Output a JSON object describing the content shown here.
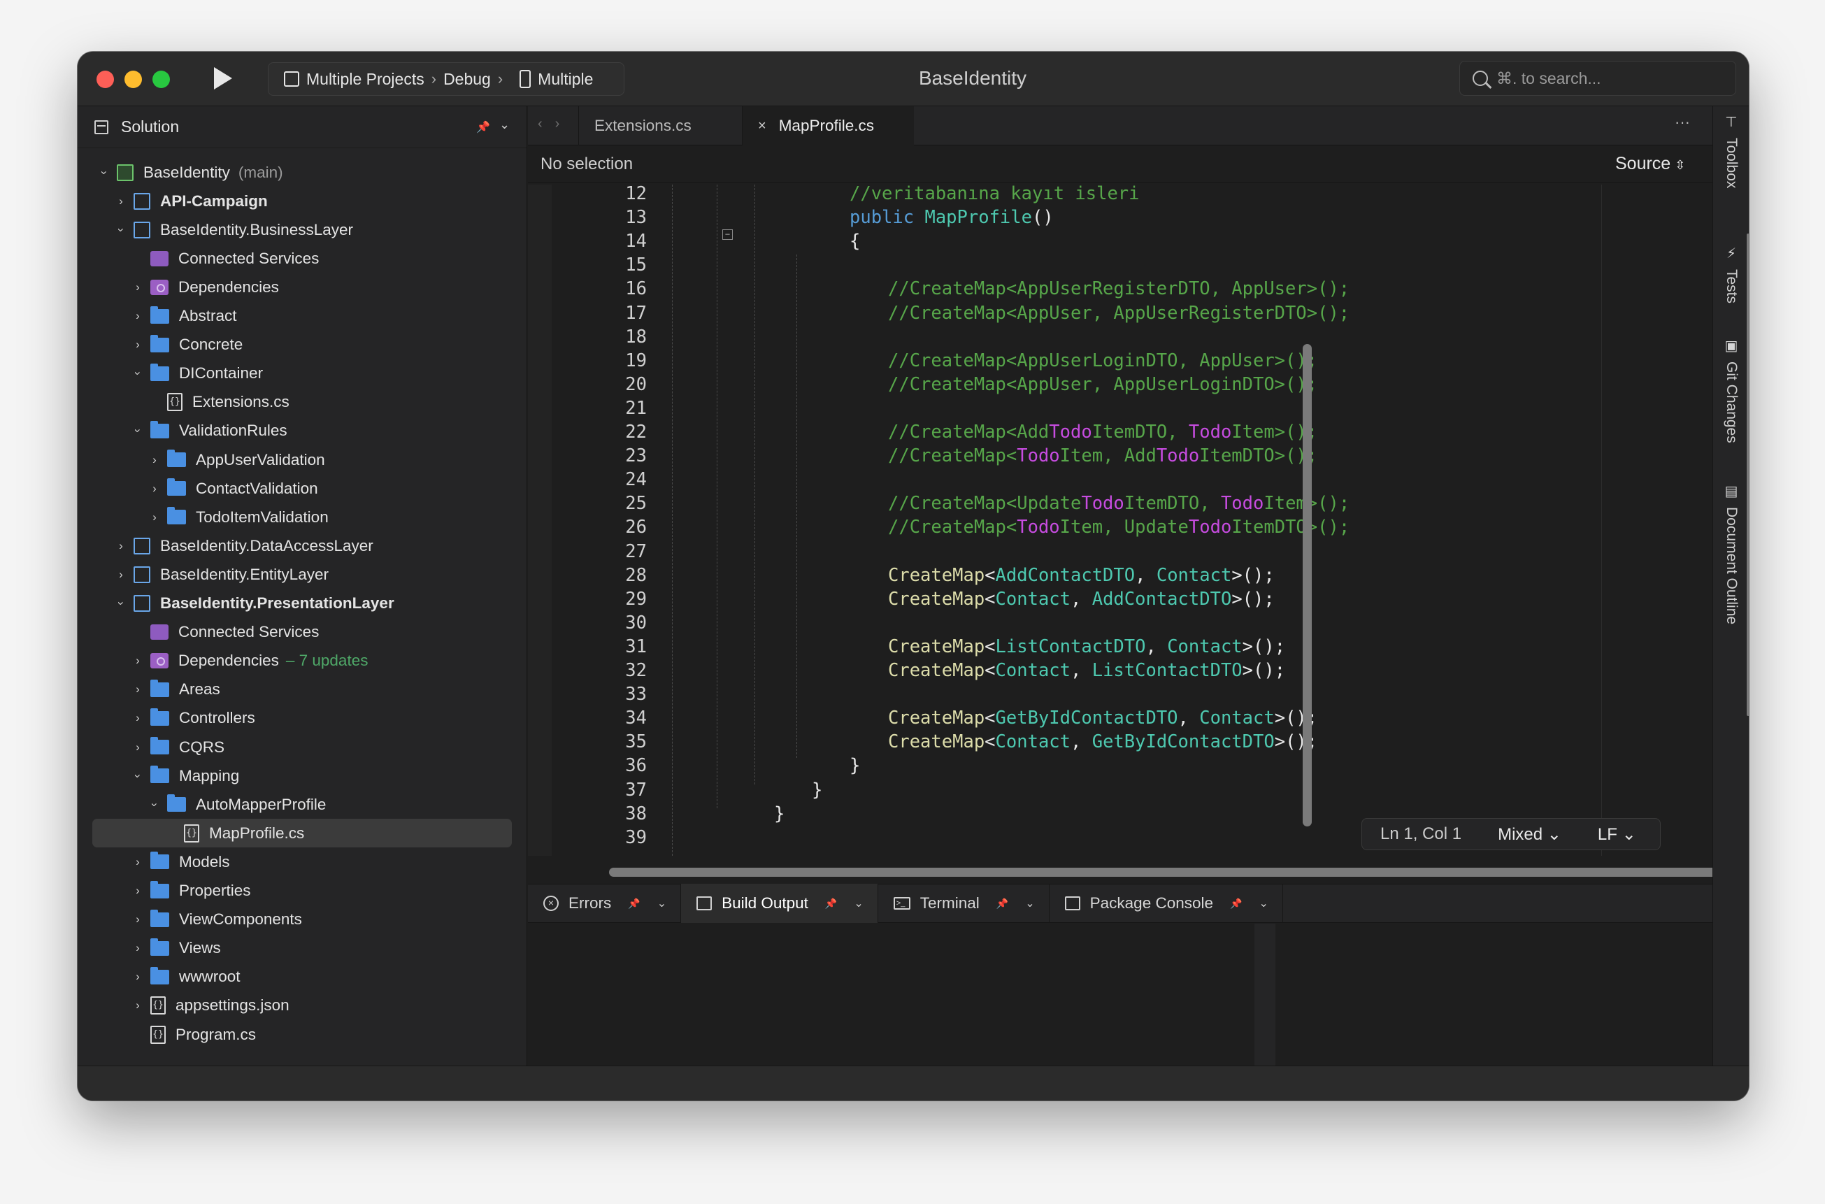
{
  "window": {
    "title": "BaseIdentity",
    "config": {
      "projects": "Multiple Projects",
      "separator": "›",
      "configuration": "Debug",
      "target": "Multiple"
    },
    "search_placeholder": "⌘. to search..."
  },
  "solution": {
    "title": "Solution",
    "tree": [
      {
        "label": "BaseIdentity",
        "note": "(main)",
        "depth": 0,
        "twisty": "open",
        "icon": "solution-icon"
      },
      {
        "label": "API-Campaign",
        "depth": 1,
        "twisty": "closed",
        "icon": "project-icon",
        "bold": true
      },
      {
        "label": "BaseIdentity.BusinessLayer",
        "depth": 1,
        "twisty": "open",
        "icon": "project-icon"
      },
      {
        "label": "Connected Services",
        "depth": 2,
        "twisty": "none",
        "icon": "connected-services-icon"
      },
      {
        "label": "Dependencies",
        "depth": 2,
        "twisty": "closed",
        "icon": "dependencies-icon"
      },
      {
        "label": "Abstract",
        "depth": 2,
        "twisty": "closed",
        "icon": "folder-icon"
      },
      {
        "label": "Concrete",
        "depth": 2,
        "twisty": "closed",
        "icon": "folder-icon"
      },
      {
        "label": "DIContainer",
        "depth": 2,
        "twisty": "open",
        "icon": "folder-icon"
      },
      {
        "label": "Extensions.cs",
        "depth": 3,
        "twisty": "none",
        "icon": "csharp-file-icon"
      },
      {
        "label": "ValidationRules",
        "depth": 2,
        "twisty": "open",
        "icon": "folder-icon"
      },
      {
        "label": "AppUserValidation",
        "depth": 3,
        "twisty": "closed",
        "icon": "folder-icon"
      },
      {
        "label": "ContactValidation",
        "depth": 3,
        "twisty": "closed",
        "icon": "folder-icon"
      },
      {
        "label": "TodoItemValidation",
        "depth": 3,
        "twisty": "closed",
        "icon": "folder-icon"
      },
      {
        "label": "BaseIdentity.DataAccessLayer",
        "depth": 1,
        "twisty": "closed",
        "icon": "project-icon"
      },
      {
        "label": "BaseIdentity.EntityLayer",
        "depth": 1,
        "twisty": "closed",
        "icon": "project-icon"
      },
      {
        "label": "BaseIdentity.PresentationLayer",
        "depth": 1,
        "twisty": "open",
        "icon": "project-icon",
        "bold": true
      },
      {
        "label": "Connected Services",
        "depth": 2,
        "twisty": "none",
        "icon": "connected-services-icon"
      },
      {
        "label": "Dependencies",
        "note_green": "– 7 updates",
        "depth": 2,
        "twisty": "closed",
        "icon": "dependencies-icon"
      },
      {
        "label": "Areas",
        "depth": 2,
        "twisty": "closed",
        "icon": "folder-icon"
      },
      {
        "label": "Controllers",
        "depth": 2,
        "twisty": "closed",
        "icon": "folder-icon"
      },
      {
        "label": "CQRS",
        "depth": 2,
        "twisty": "closed",
        "icon": "folder-icon"
      },
      {
        "label": "Mapping",
        "depth": 2,
        "twisty": "open",
        "icon": "folder-icon"
      },
      {
        "label": "AutoMapperProfile",
        "depth": 3,
        "twisty": "open",
        "icon": "folder-icon"
      },
      {
        "label": "MapProfile.cs",
        "depth": 4,
        "twisty": "none",
        "icon": "csharp-file-icon",
        "selected": true
      },
      {
        "label": "Models",
        "depth": 2,
        "twisty": "closed",
        "icon": "folder-icon"
      },
      {
        "label": "Properties",
        "depth": 2,
        "twisty": "closed",
        "icon": "folder-icon"
      },
      {
        "label": "ViewComponents",
        "depth": 2,
        "twisty": "closed",
        "icon": "folder-icon"
      },
      {
        "label": "Views",
        "depth": 2,
        "twisty": "closed",
        "icon": "folder-icon"
      },
      {
        "label": "wwwroot",
        "depth": 2,
        "twisty": "closed",
        "icon": "folder-icon"
      },
      {
        "label": "appsettings.json",
        "depth": 2,
        "twisty": "closed",
        "icon": "json-file-icon"
      },
      {
        "label": "Program.cs",
        "depth": 2,
        "twisty": "none",
        "icon": "csharp-file-icon"
      }
    ]
  },
  "editor": {
    "tabs": [
      {
        "label": "Extensions.cs",
        "active": false
      },
      {
        "label": "MapProfile.cs",
        "active": true,
        "close": "×"
      }
    ],
    "more": "···",
    "breadcrumb": "No selection",
    "source_label": "Source",
    "lines": [
      {
        "n": "12",
        "indent": 2,
        "tokens": [
          [
            "c",
            "//veritabanına kayıt isleri"
          ]
        ]
      },
      {
        "n": "13",
        "indent": 2,
        "tokens": [
          [
            "k",
            "public "
          ],
          [
            "t",
            "MapProfile"
          ],
          [
            "p",
            "()"
          ]
        ]
      },
      {
        "n": "14",
        "indent": 2,
        "tokens": [
          [
            "p",
            "{"
          ]
        ]
      },
      {
        "n": "15",
        "indent": 0,
        "tokens": []
      },
      {
        "n": "16",
        "indent": 3,
        "tokens": [
          [
            "c",
            "//CreateMap<AppUserRegisterDTO, AppUser>();"
          ]
        ]
      },
      {
        "n": "17",
        "indent": 3,
        "tokens": [
          [
            "c",
            "//CreateMap<AppUser, AppUserRegisterDTO>();"
          ]
        ]
      },
      {
        "n": "18",
        "indent": 0,
        "tokens": []
      },
      {
        "n": "19",
        "indent": 3,
        "tokens": [
          [
            "c",
            "//CreateMap<AppUserLoginDTO, AppUser>();"
          ]
        ]
      },
      {
        "n": "20",
        "indent": 3,
        "tokens": [
          [
            "c",
            "//CreateMap<AppUser, AppUserLoginDTO>();"
          ]
        ]
      },
      {
        "n": "21",
        "indent": 0,
        "tokens": []
      },
      {
        "n": "22",
        "indent": 3,
        "tokens": [
          [
            "c",
            "//CreateMap<Add"
          ],
          [
            "h",
            "Todo"
          ],
          [
            "c",
            "ItemDTO, "
          ],
          [
            "h",
            "Todo"
          ],
          [
            "c",
            "Item>();"
          ]
        ]
      },
      {
        "n": "23",
        "indent": 3,
        "tokens": [
          [
            "c",
            "//CreateMap<"
          ],
          [
            "h",
            "Todo"
          ],
          [
            "c",
            "Item, Add"
          ],
          [
            "h",
            "Todo"
          ],
          [
            "c",
            "ItemDTO>();"
          ]
        ]
      },
      {
        "n": "24",
        "indent": 0,
        "tokens": []
      },
      {
        "n": "25",
        "indent": 3,
        "tokens": [
          [
            "c",
            "//CreateMap<Update"
          ],
          [
            "h",
            "Todo"
          ],
          [
            "c",
            "ItemDTO, "
          ],
          [
            "h",
            "Todo"
          ],
          [
            "c",
            "Item>();"
          ]
        ]
      },
      {
        "n": "26",
        "indent": 3,
        "tokens": [
          [
            "c",
            "//CreateMap<"
          ],
          [
            "h",
            "Todo"
          ],
          [
            "c",
            "Item, Update"
          ],
          [
            "h",
            "Todo"
          ],
          [
            "c",
            "ItemDTO>();"
          ]
        ]
      },
      {
        "n": "27",
        "indent": 0,
        "tokens": []
      },
      {
        "n": "28",
        "indent": 3,
        "tokens": [
          [
            "m",
            "CreateMap"
          ],
          [
            "p",
            "<"
          ],
          [
            "t",
            "AddContactDTO"
          ],
          [
            "p",
            ", "
          ],
          [
            "t",
            "Contact"
          ],
          [
            "p",
            ">();"
          ]
        ]
      },
      {
        "n": "29",
        "indent": 3,
        "tokens": [
          [
            "m",
            "CreateMap"
          ],
          [
            "p",
            "<"
          ],
          [
            "t",
            "Contact"
          ],
          [
            "p",
            ", "
          ],
          [
            "t",
            "AddContactDTO"
          ],
          [
            "p",
            ">();"
          ]
        ]
      },
      {
        "n": "30",
        "indent": 0,
        "tokens": []
      },
      {
        "n": "31",
        "indent": 3,
        "tokens": [
          [
            "m",
            "CreateMap"
          ],
          [
            "p",
            "<"
          ],
          [
            "t",
            "ListContactDTO"
          ],
          [
            "p",
            ", "
          ],
          [
            "t",
            "Contact"
          ],
          [
            "p",
            ">();"
          ]
        ]
      },
      {
        "n": "32",
        "indent": 3,
        "tokens": [
          [
            "m",
            "CreateMap"
          ],
          [
            "p",
            "<"
          ],
          [
            "t",
            "Contact"
          ],
          [
            "p",
            ", "
          ],
          [
            "t",
            "ListContactDTO"
          ],
          [
            "p",
            ">();"
          ]
        ]
      },
      {
        "n": "33",
        "indent": 0,
        "tokens": []
      },
      {
        "n": "34",
        "indent": 3,
        "tokens": [
          [
            "m",
            "CreateMap"
          ],
          [
            "p",
            "<"
          ],
          [
            "t",
            "GetByIdContactDTO"
          ],
          [
            "p",
            ", "
          ],
          [
            "t",
            "Contact"
          ],
          [
            "p",
            ">();"
          ]
        ]
      },
      {
        "n": "35",
        "indent": 3,
        "tokens": [
          [
            "m",
            "CreateMap"
          ],
          [
            "p",
            "<"
          ],
          [
            "t",
            "Contact"
          ],
          [
            "p",
            ", "
          ],
          [
            "t",
            "GetByIdContactDTO"
          ],
          [
            "p",
            ">();"
          ]
        ]
      },
      {
        "n": "36",
        "indent": 2,
        "tokens": [
          [
            "p",
            "}"
          ]
        ]
      },
      {
        "n": "37",
        "indent": 1,
        "tokens": [
          [
            "p",
            "}"
          ]
        ]
      },
      {
        "n": "38",
        "indent": 0,
        "tokens": [
          [
            "p",
            "}"
          ]
        ]
      },
      {
        "n": "39",
        "indent": 0,
        "tokens": []
      }
    ],
    "status": {
      "position": "Ln 1, Col 1",
      "indentation": "Mixed",
      "line_endings": "LF"
    }
  },
  "pads": [
    {
      "label": "Errors",
      "icon": "error-icon"
    },
    {
      "label": "Build Output",
      "icon": "build-output-icon",
      "active": true
    },
    {
      "label": "Terminal",
      "icon": "terminal-icon"
    },
    {
      "label": "Package Console",
      "icon": "package-console-icon"
    }
  ],
  "dock": [
    {
      "label": "Toolbox",
      "icon": "toolbox-icon"
    },
    {
      "label": "Tests",
      "icon": "tests-icon"
    },
    {
      "label": "Git Changes",
      "icon": "git-changes-icon"
    },
    {
      "label": "Document Outline",
      "icon": "document-outline-icon"
    }
  ],
  "colors": {
    "comment": "#57a64a",
    "keyword": "#569cd6",
    "type": "#4ec9b0",
    "method": "#dcdcaa",
    "highlight": "#c74ce0",
    "folder": "#4a90e2"
  }
}
